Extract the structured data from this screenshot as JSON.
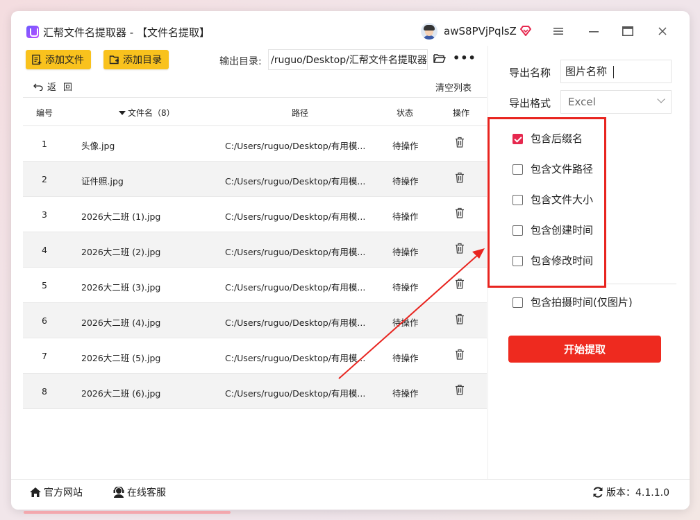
{
  "window": {
    "title": "汇帮文件名提取器 - 【文件名提取】",
    "username": "awS8PVjPqlsZ",
    "controls": {
      "menu": "≡",
      "minimize": "—",
      "maximize": "▢",
      "close": "✕"
    }
  },
  "toolbar": {
    "add_file_label": "添加文件",
    "add_dir_label": "添加目录",
    "output_dir_label": "输出目录:",
    "output_dir_value": "/ruguo/Desktop/汇帮文件名提取器",
    "more_label": "•••",
    "back_label": "返回",
    "clear_label": "清空列表"
  },
  "table": {
    "headers": {
      "no": "编号",
      "name": "文件名（8）",
      "path": "路径",
      "status": "状态",
      "op": "操作"
    },
    "rows": [
      {
        "no": "1",
        "name": "头像.jpg",
        "path": "C:/Users/ruguo/Desktop/有用模...",
        "status": "待操作"
      },
      {
        "no": "2",
        "name": "证件照.jpg",
        "path": "C:/Users/ruguo/Desktop/有用模...",
        "status": "待操作"
      },
      {
        "no": "3",
        "name": "2026大二班 (1).jpg",
        "path": "C:/Users/ruguo/Desktop/有用模...",
        "status": "待操作"
      },
      {
        "no": "4",
        "name": "2026大二班 (2).jpg",
        "path": "C:/Users/ruguo/Desktop/有用模...",
        "status": "待操作"
      },
      {
        "no": "5",
        "name": "2026大二班 (3).jpg",
        "path": "C:/Users/ruguo/Desktop/有用模...",
        "status": "待操作"
      },
      {
        "no": "6",
        "name": "2026大二班 (4).jpg",
        "path": "C:/Users/ruguo/Desktop/有用模...",
        "status": "待操作"
      },
      {
        "no": "7",
        "name": "2026大二班 (5).jpg",
        "path": "C:/Users/ruguo/Desktop/有用模...",
        "status": "待操作"
      },
      {
        "no": "8",
        "name": "2026大二班 (6).jpg",
        "path": "C:/Users/ruguo/Desktop/有用模...",
        "status": "待操作"
      }
    ]
  },
  "settings": {
    "export_name_label": "导出名称",
    "export_name_value": "图片名称",
    "export_format_label": "导出格式",
    "export_format_value": "Excel",
    "options": [
      {
        "label": "包含后缀名",
        "checked": true
      },
      {
        "label": "包含文件路径",
        "checked": false
      },
      {
        "label": "包含文件大小",
        "checked": false
      },
      {
        "label": "包含创建时间",
        "checked": false
      },
      {
        "label": "包含修改时间",
        "checked": false
      },
      {
        "label": "包含拍摄时间(仅图片)",
        "checked": false
      }
    ],
    "start_label": "开始提取"
  },
  "footer": {
    "website_label": "官方网站",
    "support_label": "在线客服",
    "version_label": "版本：4.1.1.0"
  },
  "colors": {
    "accent_yellow": "#f9c21d",
    "accent_red": "#ee2a1f",
    "check_pink": "#e6284e",
    "annotation_red": "#e8241f"
  }
}
